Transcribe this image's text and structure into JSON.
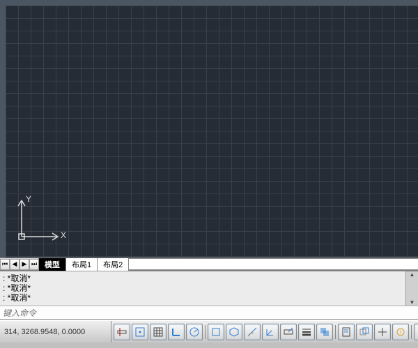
{
  "ucs": {
    "x_label": "X",
    "y_label": "Y"
  },
  "tabs": {
    "model": "模型",
    "layout1": "布局1",
    "layout2": "布局2"
  },
  "command": {
    "cancel1": ":  *取消*",
    "cancel2": ":  *取消*",
    "cancel3": ":  *取消*",
    "prompt_placeholder": "键入命令"
  },
  "status": {
    "coords": "314,  3268.9548,  0.0000"
  },
  "icons": {
    "first": "⏮",
    "prev": "◀",
    "next": "▶",
    "last": "⏭"
  },
  "colors": {
    "canvas_bg": "#252c36",
    "grid": "#394049",
    "frame": "#4a5763",
    "accent": "#2b7cd3"
  }
}
